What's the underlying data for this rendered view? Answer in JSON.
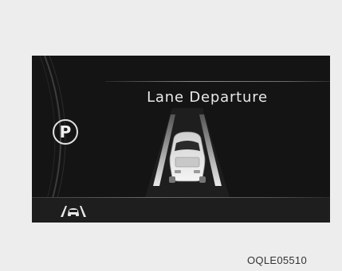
{
  "cluster": {
    "message_title": "Lane Departure",
    "gear_indicator": "P",
    "status_icon": "lane-keeping-assist-icon"
  },
  "caption": {
    "image_code": "OQLE05510"
  },
  "colors": {
    "panel_background": "#141414",
    "page_background": "#ededed",
    "text": "#e8e8e8"
  }
}
